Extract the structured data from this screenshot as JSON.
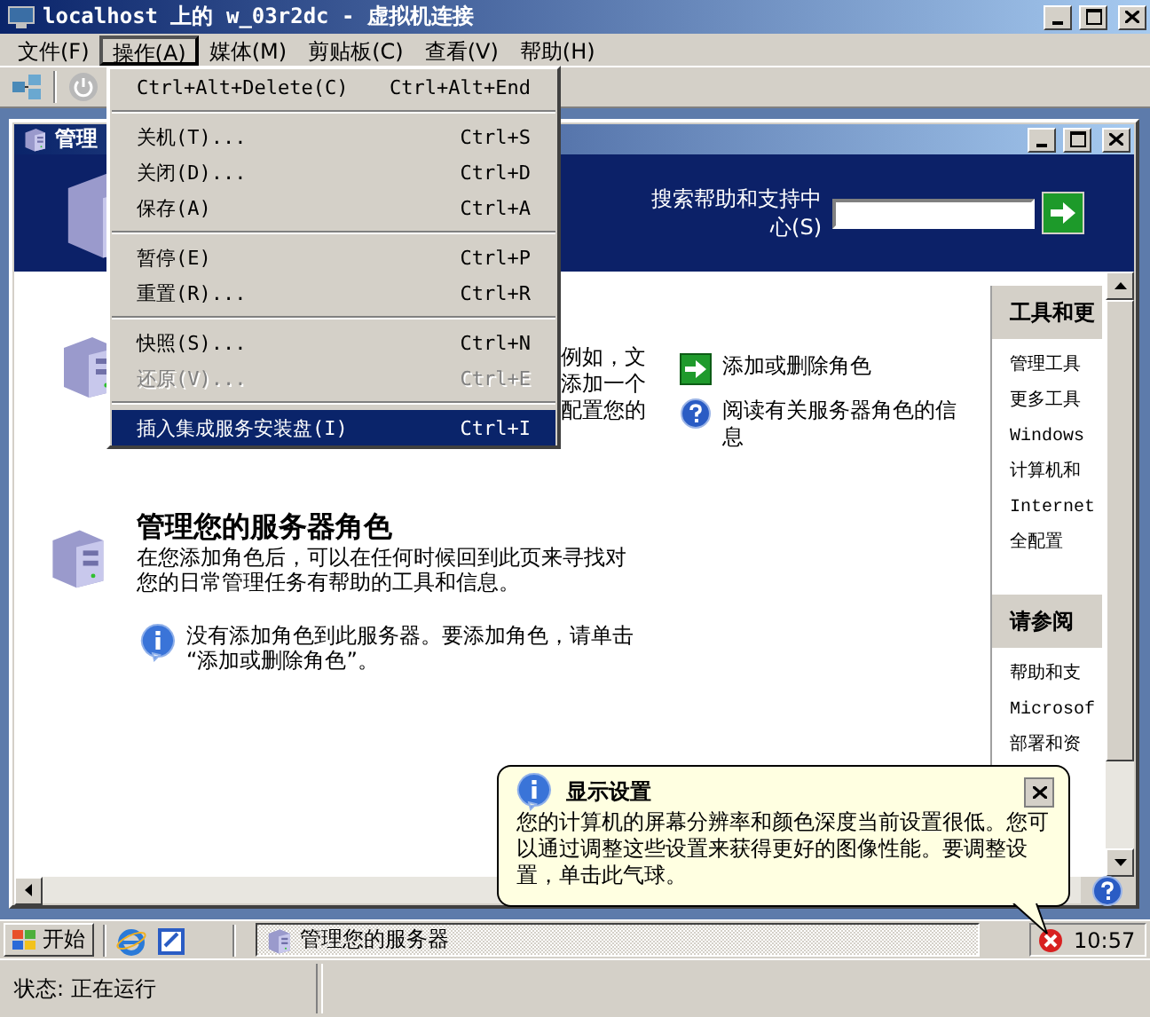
{
  "window": {
    "title": "localhost 上的 w_03r2dc - 虚拟机连接"
  },
  "menu_bar": [
    {
      "label": "文件(F)",
      "selected": false
    },
    {
      "label": "操作(A)",
      "selected": true
    },
    {
      "label": "媒体(M)",
      "selected": false
    },
    {
      "label": "剪贴板(C)",
      "selected": false
    },
    {
      "label": "查看(V)",
      "selected": false
    },
    {
      "label": "帮助(H)",
      "selected": false
    }
  ],
  "action_menu": [
    {
      "kind": "item",
      "label": "Ctrl+Alt+Delete(C)",
      "shortcut": "Ctrl+Alt+End",
      "disabled": false,
      "selected": false
    },
    {
      "kind": "separator"
    },
    {
      "kind": "item",
      "label": "关机(T)...",
      "shortcut": "Ctrl+S",
      "disabled": false,
      "selected": false
    },
    {
      "kind": "item",
      "label": "关闭(D)...",
      "shortcut": "Ctrl+D",
      "disabled": false,
      "selected": false
    },
    {
      "kind": "item",
      "label": "保存(A)",
      "shortcut": "Ctrl+A",
      "disabled": false,
      "selected": false
    },
    {
      "kind": "separator"
    },
    {
      "kind": "item",
      "label": "暂停(E)",
      "shortcut": "Ctrl+P",
      "disabled": false,
      "selected": false
    },
    {
      "kind": "item",
      "label": "重置(R)...",
      "shortcut": "Ctrl+R",
      "disabled": false,
      "selected": false
    },
    {
      "kind": "separator"
    },
    {
      "kind": "item",
      "label": "快照(S)...",
      "shortcut": "Ctrl+N",
      "disabled": false,
      "selected": false
    },
    {
      "kind": "item",
      "label": "还原(V)...",
      "shortcut": "Ctrl+E",
      "disabled": true,
      "selected": false
    },
    {
      "kind": "separator"
    },
    {
      "kind": "item",
      "label": "插入集成服务安装盘(I)",
      "shortcut": "Ctrl+I",
      "disabled": false,
      "selected": true
    }
  ],
  "guest_window": {
    "title": "管理",
    "search_label_lines": [
      "搜索帮助和支持中",
      "心(S)"
    ]
  },
  "first_section_fragment": [
    "例如，文",
    "添加一个",
    "配置您的"
  ],
  "roles_section": {
    "heading": "管理您的服务器角色",
    "description_lines": [
      "在您添加角色后，可以在任何时候回到此页来寻找对",
      "您的日常管理任务有帮助的工具和信息。"
    ],
    "notice_lines": [
      "没有添加角色到此服务器。要添加角色，请单击",
      "“添加或删除角色”。"
    ]
  },
  "tasks": [
    {
      "kind": "add",
      "lines": [
        "添加或删除角色"
      ]
    },
    {
      "kind": "help",
      "lines": [
        "阅读有关服务器角色的信",
        "息"
      ]
    }
  ],
  "right_panel": [
    {
      "heading": "工具和更",
      "items": [
        "管理工具",
        "更多工具",
        "Windows",
        "计算机和",
        "Internet",
        "全配置"
      ]
    },
    {
      "heading": "请参阅",
      "items": [
        "帮助和支",
        "Microsof",
        "部署和资"
      ]
    }
  ],
  "taskbar": {
    "start": "开始",
    "tasks": [
      {
        "label": "管理您的服务器",
        "selected": true
      }
    ],
    "clock": "10:57"
  },
  "balloon": {
    "title": "显示设置",
    "lines": [
      "您的计算机的屏幕分辨率和颜色深度当前设置很低。您可",
      "以通过调整这些设置来获得更好的图像性能。要调整设",
      "置，单击此气球。"
    ]
  },
  "status_bar": {
    "text": "状态: 正在运行"
  }
}
